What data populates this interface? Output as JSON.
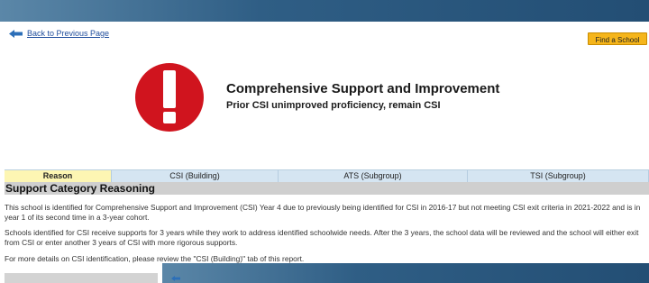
{
  "nav": {
    "back_label": "Back to Previous Page",
    "find_school_label": "Find a School"
  },
  "header": {
    "title": "Comprehensive Support and Improvement",
    "subtitle": "Prior CSI unimproved proficiency, remain CSI",
    "icon": "exclamation-icon",
    "icon_color": "#d0141e"
  },
  "tabs": [
    {
      "label": "Reason",
      "active": true
    },
    {
      "label": "CSI (Building)",
      "active": false
    },
    {
      "label": "ATS (Subgroup)",
      "active": false
    },
    {
      "label": "TSI (Subgroup)",
      "active": false
    }
  ],
  "section": {
    "heading": "Support Category Reasoning",
    "paragraphs": [
      "This school is identified for Comprehensive Support and Improvement (CSI) Year 4 due to previously being identified for CSI in 2016-17 but not meeting CSI exit criteria in 2021-2022 and is in year 1 of its second time in a 3-year cohort.",
      "Schools identified for CSI receive supports for 3 years while they work to address identified schoolwide needs. After the 3 years, the school data will be reviewed and the school will either exit from CSI or enter another 3 years of CSI with more rigorous supports.",
      "For more details on CSI identification, please review the \"CSI (Building)\" tab of this report."
    ]
  },
  "colors": {
    "accent_blue": "#234e74",
    "button_yellow": "#f5b51b",
    "active_tab": "#fdf6b3",
    "tab_bg": "#d5e5f2"
  }
}
